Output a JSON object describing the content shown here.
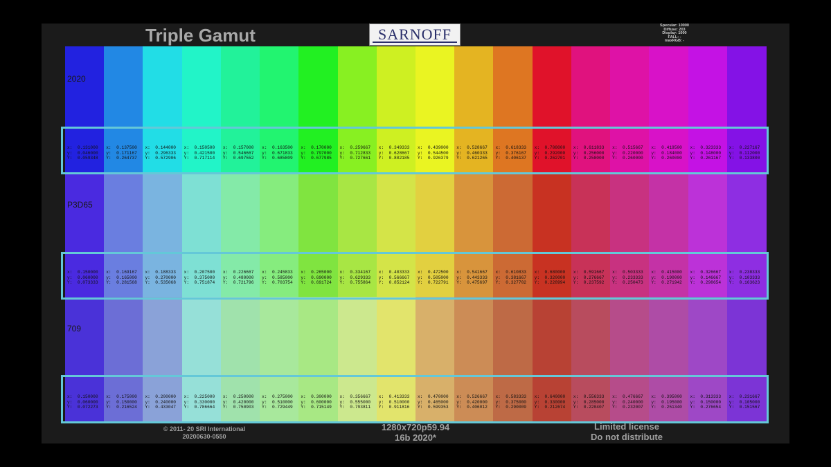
{
  "title": "Triple Gamut",
  "logo": "SARNOFF",
  "meta_lines": [
    "Specular: 10000",
    "Diffuse: 203",
    "Display: 1000",
    "FALL: -",
    "maxRGB: -"
  ],
  "gamut_labels": [
    "2020",
    "P3D65",
    "709"
  ],
  "footer": {
    "copyright": "© 2011- 20 SRI International",
    "version": "20200630-0550",
    "format": "1280x720p59.94",
    "depth": "16b 2020*",
    "license1": "Limited license",
    "license2": "Do not distribute"
  },
  "colors": {
    "highlight": "#64c8d8",
    "rec2020": [
      "#2222e0",
      "#2288e4",
      "#22dde6",
      "#22f4c8",
      "#22f29a",
      "#22f470",
      "#22f022",
      "#88f022",
      "#cef022",
      "#eaf422",
      "#e4b422",
      "#de7622",
      "#e0122a",
      "#e0127e",
      "#de12a6",
      "#d812c8",
      "#c412e4",
      "#8412e6"
    ],
    "p3": [
      "#4a2ae0",
      "#6a7ee0",
      "#7ab4e0",
      "#7ee0d4",
      "#84eaa8",
      "#86ec7e",
      "#80e440",
      "#a8e644",
      "#d4e448",
      "#e2d040",
      "#d8943c",
      "#cc6a34",
      "#c83222",
      "#c83258",
      "#c83280",
      "#c432a6",
      "#bc32d8",
      "#8e2ee2"
    ],
    "rec709": [
      "#4a32d8",
      "#6c6ed6",
      "#8aa2d8",
      "#96e0d8",
      "#a0e2ac",
      "#a8e89c",
      "#a8e884",
      "#cce88e",
      "#e2e46c",
      "#d8b06a",
      "#cc8c56",
      "#be6a46",
      "#b84234",
      "#b84c5e",
      "#b64c8a",
      "#ae4ca6",
      "#9e48c6",
      "#7c34d6"
    ]
  },
  "coords": {
    "rec2020": [
      [
        "0.131000",
        "0.046000",
        "0.059348"
      ],
      [
        "0.137500",
        "0.171167",
        "0.264737"
      ],
      [
        "0.144000",
        "0.296333",
        "0.572906"
      ],
      [
        "0.150500",
        "0.421500",
        "0.717114"
      ],
      [
        "0.157000",
        "0.546667",
        "0.697552"
      ],
      [
        "0.163500",
        "0.671833",
        "0.685809"
      ],
      [
        "0.170000",
        "0.797000",
        "0.677985"
      ],
      [
        "0.259667",
        "0.712833",
        "0.727661"
      ],
      [
        "0.349333",
        "0.628667",
        "0.802185"
      ],
      [
        "0.439000",
        "0.544500",
        "0.926379"
      ],
      [
        "0.528667",
        "0.460333",
        "0.621265"
      ],
      [
        "0.618333",
        "0.376167",
        "0.406137"
      ],
      [
        "0.708000",
        "0.292000",
        "0.262701"
      ],
      [
        "0.611833",
        "0.256000",
        "0.258000"
      ],
      [
        "0.515667",
        "0.220000",
        "0.260000"
      ],
      [
        "0.419500",
        "0.184000",
        "0.260000"
      ],
      [
        "0.323333",
        "0.148000",
        "0.261167"
      ],
      [
        "0.227167",
        "0.112000",
        "0.133800"
      ]
    ],
    "p3": [
      [
        "0.150000",
        "0.060000",
        "0.073333"
      ],
      [
        "0.169167",
        "0.165000",
        "0.281568"
      ],
      [
        "0.188333",
        "0.270000",
        "0.535068"
      ],
      [
        "0.207500",
        "0.375000",
        "0.751874"
      ],
      [
        "0.226667",
        "0.480000",
        "0.721796"
      ],
      [
        "0.245833",
        "0.585000",
        "0.703754"
      ],
      [
        "0.265000",
        "0.690000",
        "0.691724"
      ],
      [
        "0.334167",
        "0.629333",
        "0.755864"
      ],
      [
        "0.403333",
        "0.566667",
        "0.852124"
      ],
      [
        "0.472500",
        "0.505000",
        "0.722791"
      ],
      [
        "0.541667",
        "0.443333",
        "0.475697"
      ],
      [
        "0.610833",
        "0.381667",
        "0.327702"
      ],
      [
        "0.680000",
        "0.320000",
        "0.228994"
      ],
      [
        "0.591667",
        "0.276667",
        "0.237592"
      ],
      [
        "0.503333",
        "0.233333",
        "0.250473"
      ],
      [
        "0.415000",
        "0.190000",
        "0.271942"
      ],
      [
        "0.326667",
        "0.146667",
        "0.298654"
      ],
      [
        "0.238333",
        "0.103333",
        "0.163623"
      ]
    ],
    "rec709": [
      [
        "0.150000",
        "0.060000",
        "0.072273"
      ],
      [
        "0.175000",
        "0.150000",
        "0.216524"
      ],
      [
        "0.200000",
        "0.240000",
        "0.433047"
      ],
      [
        "0.225000",
        "0.330000",
        "0.786664"
      ],
      [
        "0.250000",
        "0.420000",
        "0.750903"
      ],
      [
        "0.275000",
        "0.510000",
        "0.729449"
      ],
      [
        "0.300000",
        "0.600000",
        "0.715149"
      ],
      [
        "0.356667",
        "0.555000",
        "0.793811"
      ],
      [
        "0.413333",
        "0.510000",
        "0.911816"
      ],
      [
        "0.470000",
        "0.465000",
        "0.599353"
      ],
      [
        "0.526667",
        "0.420000",
        "0.406012"
      ],
      [
        "0.583333",
        "0.375000",
        "0.290009"
      ],
      [
        "0.640000",
        "0.330000",
        "0.212674"
      ],
      [
        "0.556333",
        "0.285000",
        "0.220407"
      ],
      [
        "0.476667",
        "0.240000",
        "0.232007"
      ],
      [
        "0.395000",
        "0.195000",
        "0.251340"
      ],
      [
        "0.313333",
        "0.150000",
        "0.276654"
      ],
      [
        "0.231667",
        "0.105000",
        "0.151567"
      ]
    ]
  }
}
